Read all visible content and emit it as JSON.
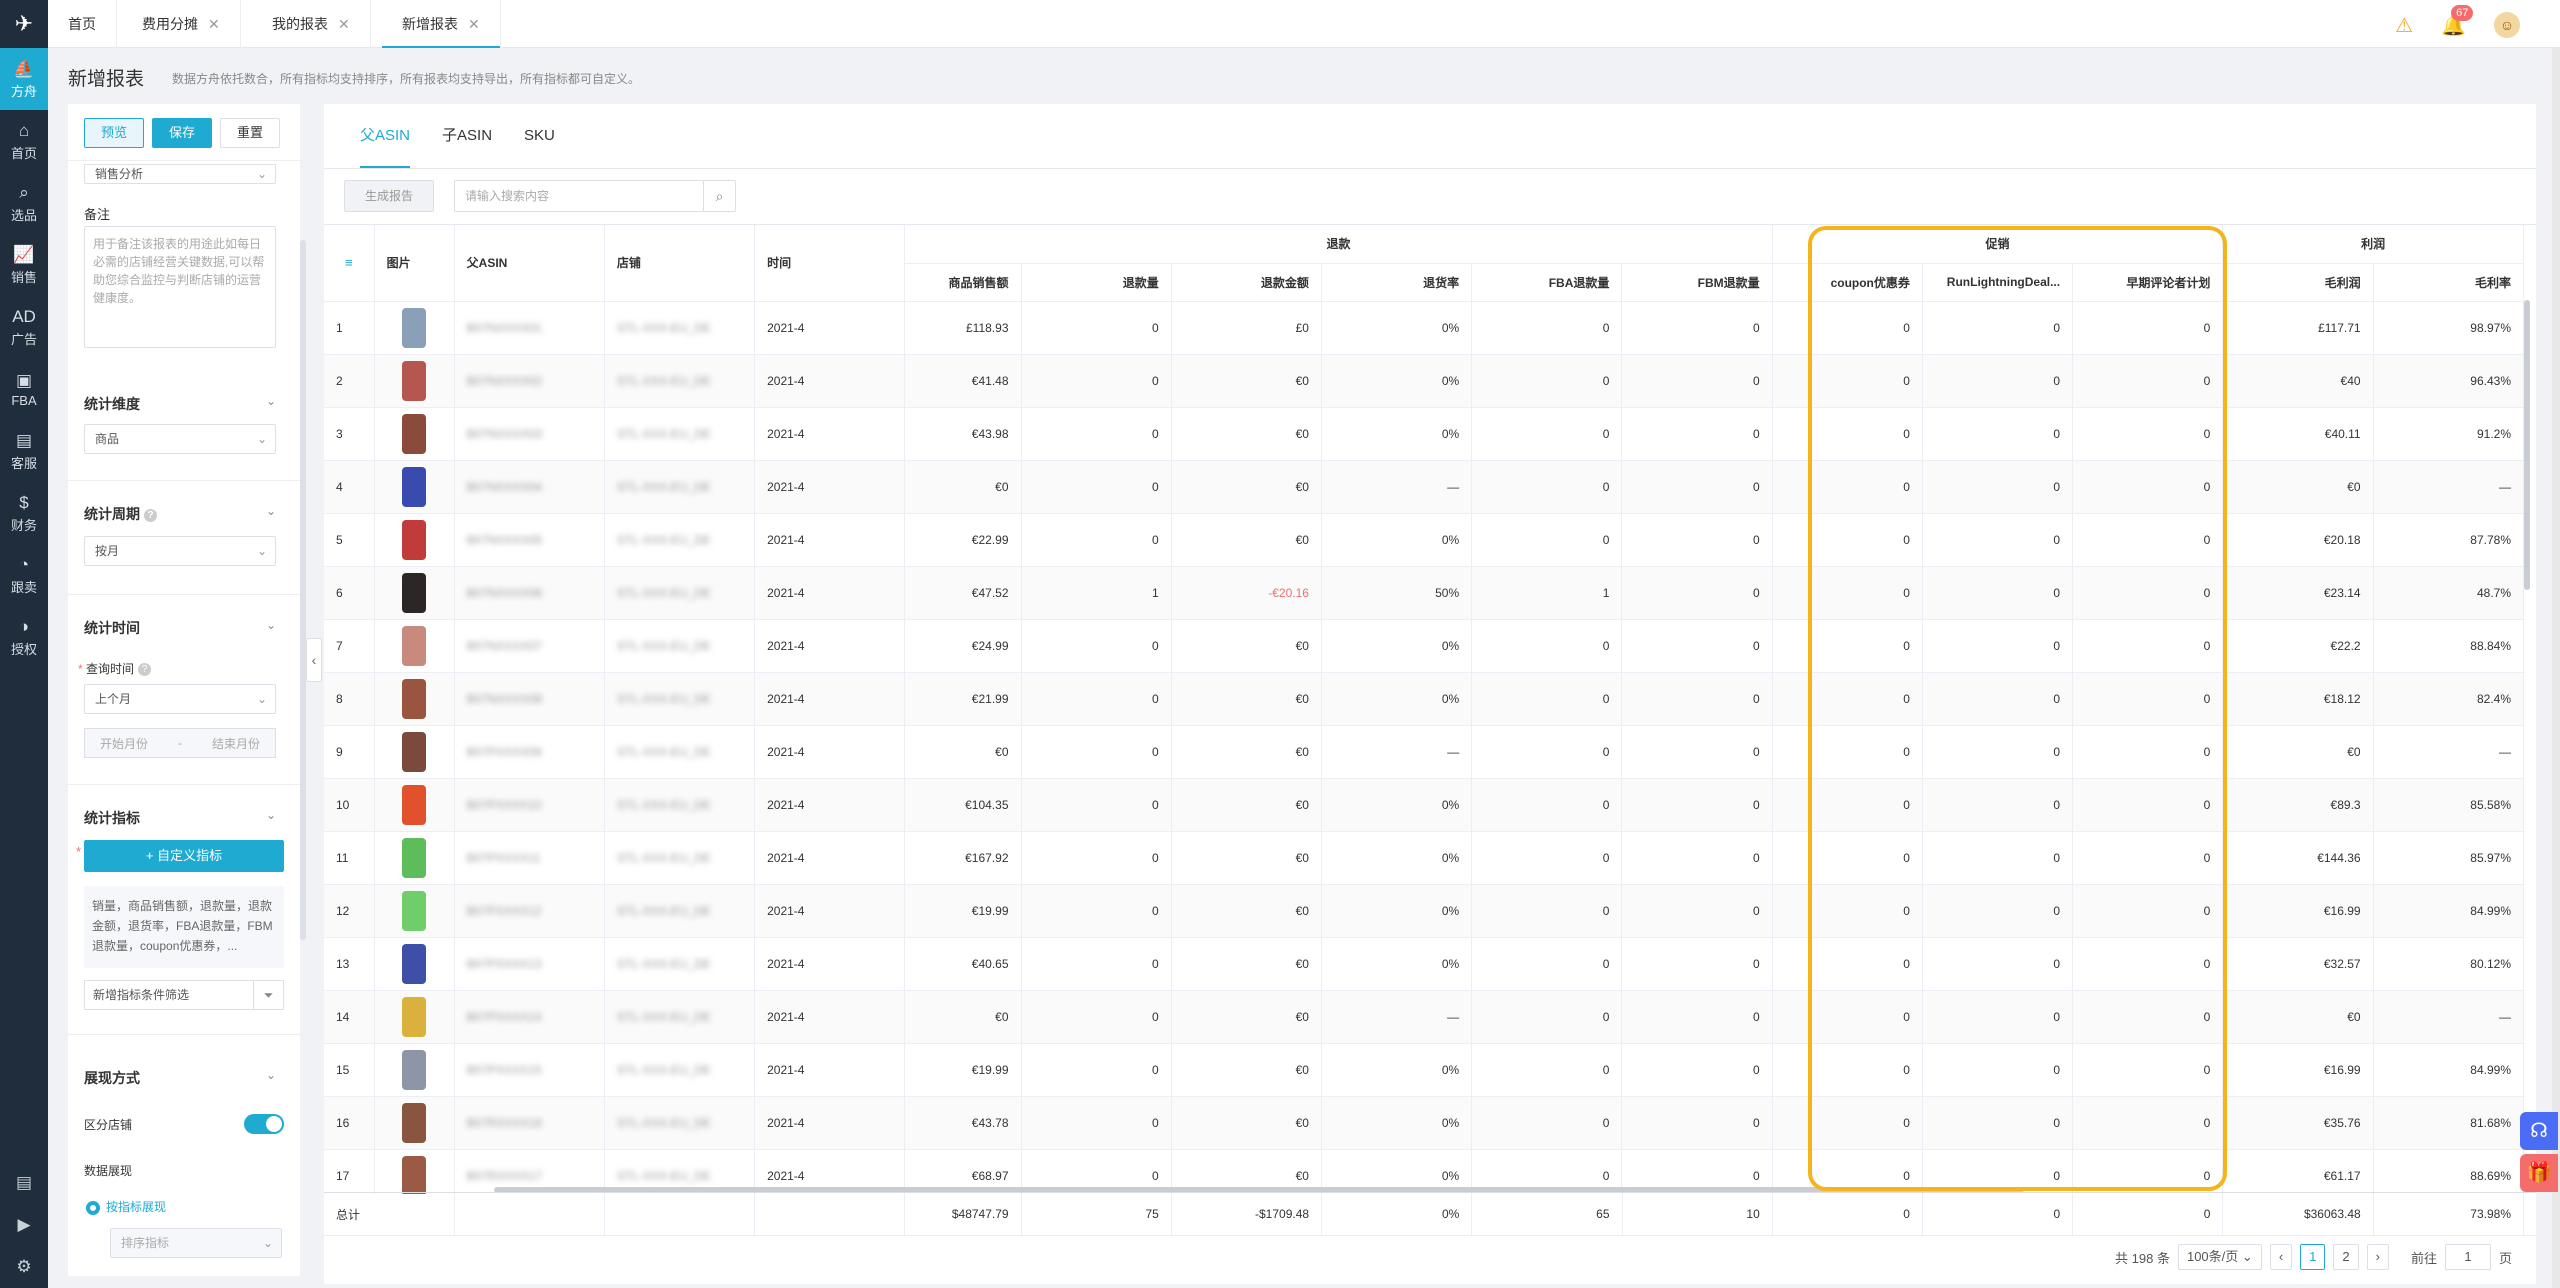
{
  "nav": {
    "items": [
      {
        "label": "方舟",
        "icon": "boat-icon",
        "glyph": "⛵",
        "active": true
      },
      {
        "label": "首页",
        "icon": "home-icon",
        "glyph": "⌂",
        "active": false
      },
      {
        "label": "选品",
        "icon": "search-icon",
        "glyph": "⌕",
        "active": false
      },
      {
        "label": "销售",
        "icon": "chart-icon",
        "glyph": "📈",
        "active": false
      },
      {
        "label": "广告",
        "icon": "ad-icon",
        "glyph": "AD",
        "active": false
      },
      {
        "label": "FBA",
        "icon": "fba-icon",
        "glyph": "▣",
        "active": false
      },
      {
        "label": "客服",
        "icon": "service-icon",
        "glyph": "▤",
        "active": false
      },
      {
        "label": "财务",
        "icon": "finance-icon",
        "glyph": "$",
        "active": false
      },
      {
        "label": "跟卖",
        "icon": "follow-sell-icon",
        "glyph": "◔",
        "active": false
      },
      {
        "label": "授权",
        "icon": "authorize-icon",
        "glyph": "◑",
        "active": false
      }
    ]
  },
  "topbar": {
    "tabs": [
      {
        "label": "首页",
        "closable": false
      },
      {
        "label": "费用分摊",
        "closable": true
      },
      {
        "label": "我的报表",
        "closable": true
      },
      {
        "label": "新增报表",
        "closable": true,
        "active": true
      }
    ],
    "notification_count": "67"
  },
  "page": {
    "title": "新增报表",
    "desc": "数据方舟依托数合，所有指标均支持排序，所有报表均支持导出，所有指标都可自定义。"
  },
  "left": {
    "preview": "预览",
    "save": "保存",
    "reset": "重置",
    "analysis_type": "销售分析",
    "remark_label": "备注",
    "remark_placeholder": "用于备注该报表的用途此如每日必需的店铺经营关键数据,可以帮助您综合监控与判断店铺的运营健康度。",
    "dimension_label": "统计维度",
    "dimension_value": "商品",
    "period_label": "统计周期",
    "period_value": "按月",
    "time_label": "统计时间",
    "query_time_label": "查询时间",
    "query_time_value": "上个月",
    "start_month": "开始月份",
    "end_month": "结束月份",
    "metrics_label": "统计指标",
    "add_metric": "+ 自定义指标",
    "metrics_summary": "销量，商品销售额，退款量，退款金额，退货率，FBA退款量，FBM退款量，coupon优惠券，...",
    "filter_placeholder": "新增指标条件筛选",
    "display_label": "展现方式",
    "split_store_label": "区分店铺",
    "data_display_label": "数据展现",
    "by_metric": "按指标展现",
    "sort_metric": "排序指标"
  },
  "main": {
    "tabs": [
      "父ASIN",
      "子ASIN",
      "SKU"
    ],
    "generate": "生成报告",
    "search_placeholder": "请输入搜索内容"
  },
  "table": {
    "groups": {
      "refund": "退款",
      "promo": "促销",
      "profit": "利润"
    },
    "headers": {
      "image": "图片",
      "asin": "父ASIN",
      "store": "店铺",
      "time": "时间",
      "sales": "商品销售额",
      "refund_qty": "退款量",
      "refund_amt": "退款金额",
      "return_rate": "退货率",
      "fba_refund": "FBA退款量",
      "fbm_refund": "FBM退款量",
      "coupon": "coupon优惠券",
      "lightning": "RunLightningDeal...",
      "early_review": "早期评论者计划",
      "gross_profit": "毛利润",
      "gross_margin": "毛利率"
    },
    "rows": [
      {
        "idx": "1",
        "asin": "B07NXXXX01",
        "store": "STL-XXX-EU_DE",
        "time": "2021-4",
        "sales": "£118.93",
        "refund_qty": "0",
        "refund_amt": "£0",
        "rate": "0%",
        "fba": "0",
        "fbm": "0",
        "coupon": "0",
        "lightning": "0",
        "early": "0",
        "profit": "£117.71",
        "margin": "98.97%",
        "img": "#8aa0b8",
        "neg": false
      },
      {
        "idx": "2",
        "asin": "B07NXXXX02",
        "store": "STL-XXX-EU_DE",
        "time": "2021-4",
        "sales": "€41.48",
        "refund_qty": "0",
        "refund_amt": "€0",
        "rate": "0%",
        "fba": "0",
        "fbm": "0",
        "coupon": "0",
        "lightning": "0",
        "early": "0",
        "profit": "€40",
        "margin": "96.43%",
        "img": "#b5574f",
        "neg": false
      },
      {
        "idx": "3",
        "asin": "B07NXXXX03",
        "store": "STL-XXX-EU_DE",
        "time": "2021-4",
        "sales": "€43.98",
        "refund_qty": "0",
        "refund_amt": "€0",
        "rate": "0%",
        "fba": "0",
        "fbm": "0",
        "coupon": "0",
        "lightning": "0",
        "early": "0",
        "profit": "€40.11",
        "margin": "91.2%",
        "img": "#8a4b3c",
        "neg": false
      },
      {
        "idx": "4",
        "asin": "B07NXXXX04",
        "store": "STL-XXX-EU_DE",
        "time": "2021-4",
        "sales": "€0",
        "refund_qty": "0",
        "refund_amt": "€0",
        "rate": "—",
        "fba": "0",
        "fbm": "0",
        "coupon": "0",
        "lightning": "0",
        "early": "0",
        "profit": "€0",
        "margin": "—",
        "img": "#3a4bb0",
        "neg": false
      },
      {
        "idx": "5",
        "asin": "B07NXXXX05",
        "store": "STL-XXX-EU_DE",
        "time": "2021-4",
        "sales": "€22.99",
        "refund_qty": "0",
        "refund_amt": "€0",
        "rate": "0%",
        "fba": "0",
        "fbm": "0",
        "coupon": "0",
        "lightning": "0",
        "early": "0",
        "profit": "€20.18",
        "margin": "87.78%",
        "img": "#c23b3b",
        "neg": false
      },
      {
        "idx": "6",
        "asin": "B07NXXXX06",
        "store": "STL-XXX-EU_DE",
        "time": "2021-4",
        "sales": "€47.52",
        "refund_qty": "1",
        "refund_amt": "-€20.16",
        "rate": "50%",
        "fba": "1",
        "fbm": "0",
        "coupon": "0",
        "lightning": "0",
        "early": "0",
        "profit": "€23.14",
        "margin": "48.7%",
        "img": "#2c2626",
        "neg": true
      },
      {
        "idx": "7",
        "asin": "B07NXXXX07",
        "store": "STL-XXX-EU_DE",
        "time": "2021-4",
        "sales": "€24.99",
        "refund_qty": "0",
        "refund_amt": "€0",
        "rate": "0%",
        "fba": "0",
        "fbm": "0",
        "coupon": "0",
        "lightning": "0",
        "early": "0",
        "profit": "€22.2",
        "margin": "88.84%",
        "img": "#c88a7c",
        "neg": false
      },
      {
        "idx": "8",
        "asin": "B07NXXXX08",
        "store": "STL-XXX-EU_DE",
        "time": "2021-4",
        "sales": "€21.99",
        "refund_qty": "0",
        "refund_amt": "€0",
        "rate": "0%",
        "fba": "0",
        "fbm": "0",
        "coupon": "0",
        "lightning": "0",
        "early": "0",
        "profit": "€18.12",
        "margin": "82.4%",
        "img": "#9a5540",
        "neg": false
      },
      {
        "idx": "9",
        "asin": "B07PXXXX09",
        "store": "STL-XXX-EU_DE",
        "time": "2021-4",
        "sales": "€0",
        "refund_qty": "0",
        "refund_amt": "€0",
        "rate": "—",
        "fba": "0",
        "fbm": "0",
        "coupon": "0",
        "lightning": "0",
        "early": "0",
        "profit": "€0",
        "margin": "—",
        "img": "#7b4a3c",
        "neg": false
      },
      {
        "idx": "10",
        "asin": "B07PXXXX10",
        "store": "STL-XXX-EU_DE",
        "time": "2021-4",
        "sales": "€104.35",
        "refund_qty": "0",
        "refund_amt": "€0",
        "rate": "0%",
        "fba": "0",
        "fbm": "0",
        "coupon": "0",
        "lightning": "0",
        "early": "0",
        "profit": "€89.3",
        "margin": "85.58%",
        "img": "#e0512c",
        "neg": false
      },
      {
        "idx": "11",
        "asin": "B07PXXXX11",
        "store": "STL-XXX-EU_DE",
        "time": "2021-4",
        "sales": "€167.92",
        "refund_qty": "0",
        "refund_amt": "€0",
        "rate": "0%",
        "fba": "0",
        "fbm": "0",
        "coupon": "0",
        "lightning": "0",
        "early": "0",
        "profit": "€144.36",
        "margin": "85.97%",
        "img": "#5cbd5a",
        "neg": false
      },
      {
        "idx": "12",
        "asin": "B07PXXXX12",
        "store": "STL-XXX-EU_DE",
        "time": "2021-4",
        "sales": "€19.99",
        "refund_qty": "0",
        "refund_amt": "€0",
        "rate": "0%",
        "fba": "0",
        "fbm": "0",
        "coupon": "0",
        "lightning": "0",
        "early": "0",
        "profit": "€16.99",
        "margin": "84.99%",
        "img": "#6fce6a",
        "neg": false
      },
      {
        "idx": "13",
        "asin": "B07PXXXX13",
        "store": "STL-XXX-EU_DE",
        "time": "2021-4",
        "sales": "€40.65",
        "refund_qty": "0",
        "refund_amt": "€0",
        "rate": "0%",
        "fba": "0",
        "fbm": "0",
        "coupon": "0",
        "lightning": "0",
        "early": "0",
        "profit": "€32.57",
        "margin": "80.12%",
        "img": "#3e4fa8",
        "neg": false
      },
      {
        "idx": "14",
        "asin": "B07PXXXX14",
        "store": "STL-XXX-EU_DE",
        "time": "2021-4",
        "sales": "€0",
        "refund_qty": "0",
        "refund_amt": "€0",
        "rate": "—",
        "fba": "0",
        "fbm": "0",
        "coupon": "0",
        "lightning": "0",
        "early": "0",
        "profit": "€0",
        "margin": "—",
        "img": "#d9b13c",
        "neg": false
      },
      {
        "idx": "15",
        "asin": "B07PXXXX15",
        "store": "STL-XXX-EU_DE",
        "time": "2021-4",
        "sales": "€19.99",
        "refund_qty": "0",
        "refund_amt": "€0",
        "rate": "0%",
        "fba": "0",
        "fbm": "0",
        "coupon": "0",
        "lightning": "0",
        "early": "0",
        "profit": "€16.99",
        "margin": "84.99%",
        "img": "#8d95a6",
        "neg": false
      },
      {
        "idx": "16",
        "asin": "B07RXXXX16",
        "store": "STL-XXX-EU_DE",
        "time": "2021-4",
        "sales": "€43.78",
        "refund_qty": "0",
        "refund_amt": "€0",
        "rate": "0%",
        "fba": "0",
        "fbm": "0",
        "coupon": "0",
        "lightning": "0",
        "early": "0",
        "profit": "€35.76",
        "margin": "81.68%",
        "img": "#8a5540",
        "neg": false
      },
      {
        "idx": "17",
        "asin": "B07RXXXX17",
        "store": "STL-XXX-EU_DE",
        "time": "2021-4",
        "sales": "€68.97",
        "refund_qty": "0",
        "refund_amt": "€0",
        "rate": "0%",
        "fba": "0",
        "fbm": "0",
        "coupon": "0",
        "lightning": "0",
        "early": "0",
        "profit": "€61.17",
        "margin": "88.69%",
        "img": "#9a5a44",
        "neg": false
      }
    ],
    "total": {
      "label": "总计",
      "sales": "$48747.79",
      "refund_qty": "75",
      "refund_amt": "-$1709.48",
      "rate": "0%",
      "fba": "65",
      "fbm": "10",
      "coupon": "0",
      "lightning": "0",
      "early": "0",
      "profit": "$36063.48",
      "margin": "73.98%"
    }
  },
  "pager": {
    "total": "共 198 条",
    "page_size": "100条/页",
    "pages": [
      "1",
      "2"
    ],
    "goto_prefix": "前往",
    "goto_value": "1",
    "goto_suffix": "页"
  },
  "colors": {
    "accent": "#1eaad1",
    "highlight": "#f5b51a",
    "nav_bg": "#1f2d3d",
    "negative": "#f56c6c"
  }
}
